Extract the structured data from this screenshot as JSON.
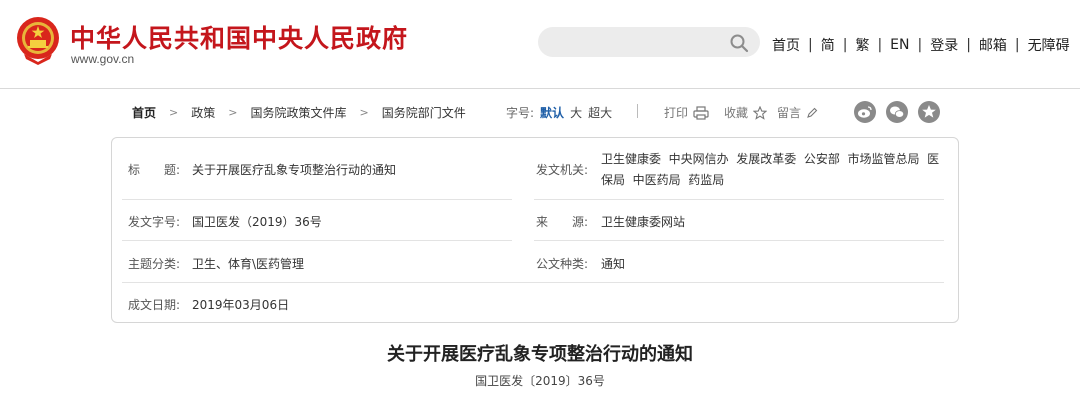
{
  "header": {
    "site_title": "中华人民共和国中央人民政府",
    "site_url": "www.gov.cn",
    "search_placeholder": "",
    "nav": [
      "首页",
      "简",
      "繁",
      "EN",
      "登录",
      "邮箱",
      "无障碍"
    ],
    "nav_separator": "|",
    "brand_color": "#c4161c"
  },
  "toolbar": {
    "breadcrumb": [
      "首页",
      "政策",
      "国务院政策文件库",
      "国务院部门文件"
    ],
    "breadcrumb_separator": ">",
    "fontsize_label": "字号:",
    "fontsize_options": [
      "默认",
      "大",
      "超大"
    ],
    "fontsize_active": "默认",
    "print_label": "打印",
    "favorite_label": "收藏",
    "comment_label": "留言",
    "share_icons": [
      "weibo-icon",
      "wechat-icon",
      "qzone-icon"
    ]
  },
  "info": {
    "title_label": "标　　题:",
    "title_value": "关于开展医疗乱象专项整治行动的通知",
    "issuer_label": "发文机关:",
    "issuer_line1": "卫生健康委  中央网信办  发展改革委  公安部  市场监管总局  医",
    "issuer_line2": "保局  中医药局  药监局",
    "doc_no_label": "发文字号:",
    "doc_no_value": "国卫医发（2019）36号",
    "source_label": "来　　源:",
    "source_value": "卫生健康委网站",
    "topic_label": "主题分类:",
    "topic_value": "卫生、体育\\医药管理",
    "type_label": "公文种类:",
    "type_value": "通知",
    "date_label": "成文日期:",
    "date_value": "2019年03月06日"
  },
  "article": {
    "title": "关于开展医疗乱象专项整治行动的通知",
    "number": "国卫医发〔2019〕36号"
  }
}
